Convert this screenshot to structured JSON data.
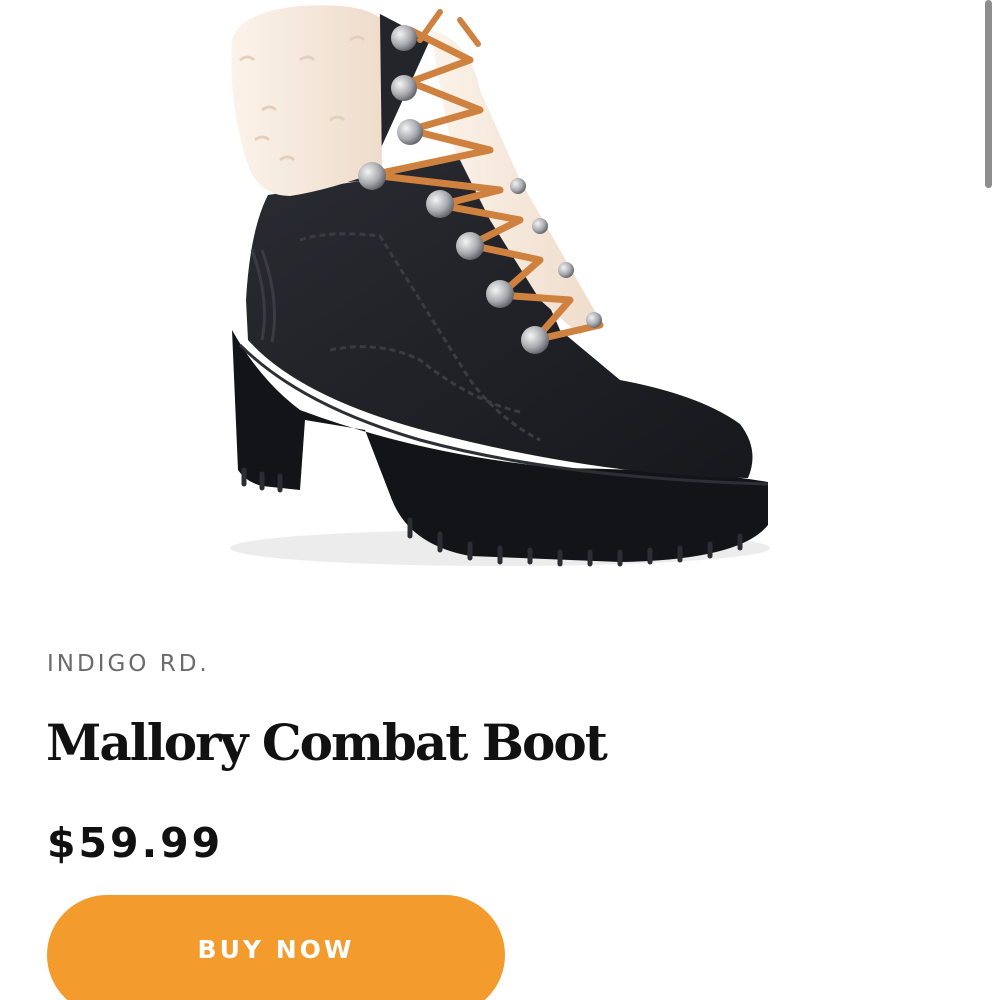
{
  "product": {
    "brand": "INDIGO RD.",
    "name": "Mallory Combat Boot",
    "price": "$59.99",
    "image_subject": "black lace-up combat boot with cream shearling cuff and orange laces"
  },
  "actions": {
    "buy_label": "BUY NOW"
  },
  "colors": {
    "accent": "#f39b2d",
    "boot": "#1f2026",
    "shearling": "#f5e8da",
    "laces": "#cf8240",
    "text_primary": "#111111",
    "text_secondary": "#6b6b6b"
  }
}
